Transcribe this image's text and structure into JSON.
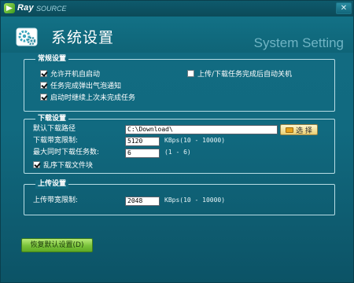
{
  "app": {
    "logo_text": "Ray",
    "logo_sub": "SOURCE",
    "close_label": "✕"
  },
  "header": {
    "title": "系统设置",
    "subtitle": "System Setting"
  },
  "general": {
    "legend": "常规设置",
    "options": [
      {
        "label": "允许开机自启动",
        "checked": true
      },
      {
        "label": "任务完成弹出气泡通知",
        "checked": true
      },
      {
        "label": "启动时继续上次未完成任务",
        "checked": true
      },
      {
        "label": "上传/下载任务完成后自动关机",
        "checked": false
      }
    ]
  },
  "download": {
    "legend": "下载设置",
    "path_label": "默认下载路径",
    "path_value": "C:\\Download\\",
    "browse_label": "选 择",
    "speed_label": "下载带宽限制:",
    "speed_value": "5120",
    "speed_hint": "KBps(10 - 10000)",
    "max_tasks_label": "最大同时下载任务数:",
    "max_tasks_value": "6",
    "max_tasks_hint": "(1 - 6)",
    "random_label": "乱序下载文件块",
    "random_checked": true
  },
  "upload": {
    "legend": "上传设置",
    "speed_label": "上传带宽限制:",
    "speed_value": "2048",
    "speed_hint": "KBps(10 - 10000)"
  },
  "footer": {
    "restore_label": "恢复默认设置(D)"
  },
  "colors": {
    "background": "#116a80",
    "restore_button": "#79c23a",
    "browse_button": "#e9cf72"
  }
}
